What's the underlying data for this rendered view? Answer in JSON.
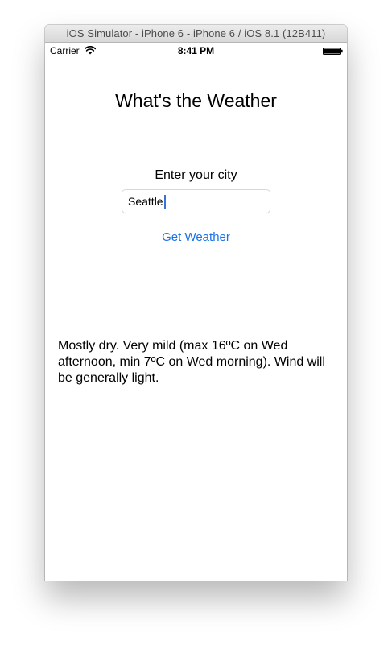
{
  "window": {
    "title": "iOS Simulator - iPhone 6 - iPhone 6 / iOS 8.1 (12B411)"
  },
  "status_bar": {
    "carrier": "Carrier",
    "time": "8:41 PM",
    "wifi_icon": "wifi-icon",
    "battery_icon": "battery-icon",
    "battery_level": 1.0
  },
  "app": {
    "title": "What's the Weather",
    "city_label": "Enter your city",
    "city_input": {
      "value": "Seattle",
      "placeholder": ""
    },
    "get_weather_label": "Get Weather",
    "forecast": "Mostly dry. Very mild (max 16ºC on Wed afternoon, min 7ºC on Wed morning). Wind will be generally light.",
    "accent_color": "#1a73e8"
  }
}
